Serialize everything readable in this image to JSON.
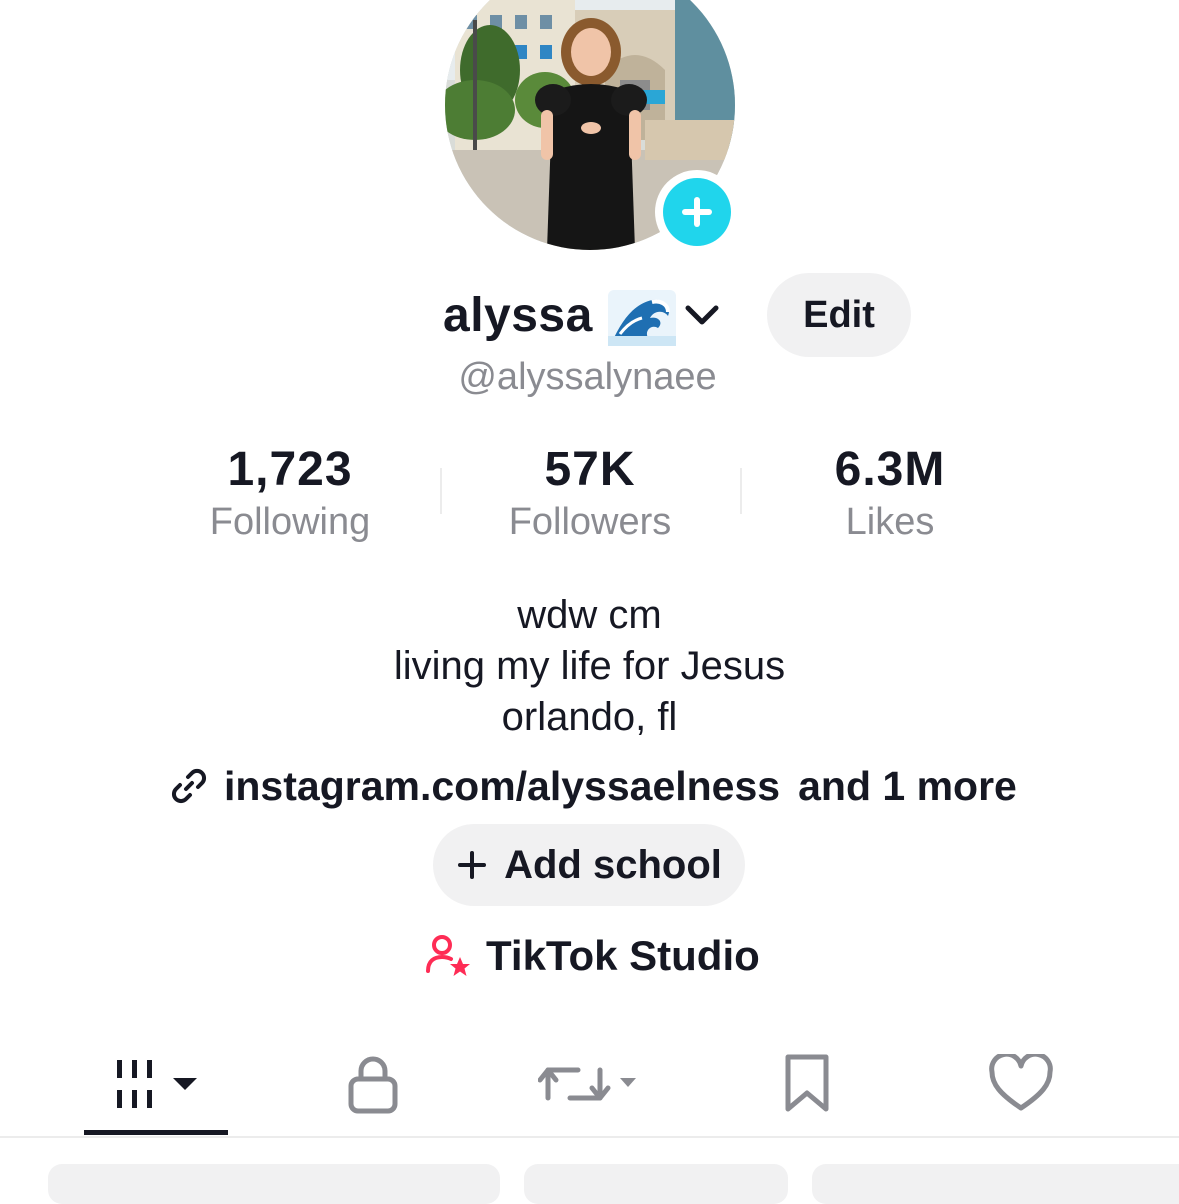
{
  "profile": {
    "name": "alyssa",
    "name_emoji": "wave-emoji",
    "handle": "@alyssalynaee",
    "edit_label": "Edit"
  },
  "stats": [
    {
      "value": "1,723",
      "label": "Following"
    },
    {
      "value": "57K",
      "label": "Followers"
    },
    {
      "value": "6.3M",
      "label": "Likes"
    }
  ],
  "bio": {
    "lines": [
      "wdw cm",
      "living my life for Jesus",
      "orlando, fl"
    ]
  },
  "links": {
    "primary": "instagram.com/alyssaelness",
    "more": "and 1 more"
  },
  "actions": {
    "add_school": "Add school",
    "studio": "TikTok Studio"
  },
  "tabs": [
    {
      "icon": "videos-grid-icon",
      "active": true
    },
    {
      "icon": "lock-icon",
      "active": false
    },
    {
      "icon": "repost-icon",
      "active": false
    },
    {
      "icon": "bookmark-icon",
      "active": false
    },
    {
      "icon": "heart-icon",
      "active": false
    }
  ],
  "colors": {
    "accent_cyan": "#20d5ec",
    "studio_pink": "#fe2c55",
    "text_primary": "#161823",
    "text_secondary": "#8a8b91",
    "button_bg": "#f1f1f2"
  }
}
